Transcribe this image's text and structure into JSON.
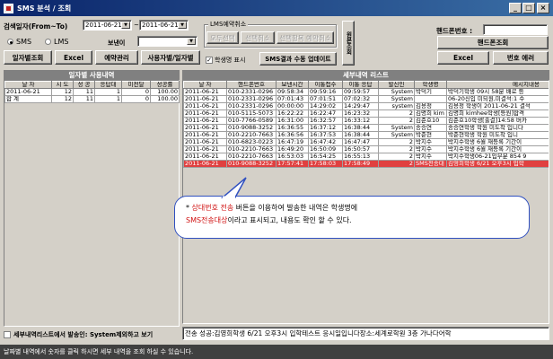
{
  "window": {
    "title": "SMS 분석 / 조회"
  },
  "search": {
    "period_label": "검색일자(From~To)",
    "from_date": "2011-06-21",
    "to_date": "2011-06-21",
    "tilde": "~",
    "radio_sms": "SMS",
    "radio_lms": "LMS",
    "sender_label": "보낸이",
    "sender_value": "",
    "btn_daily": "일자별조회",
    "btn_excel": "Excel",
    "btn_reserve": "예약관리",
    "btn_user": "사용자별/일자별"
  },
  "lms": {
    "group_label": "LMS예약취소",
    "btn_select_all": "모두선택",
    "btn_cancel_selected": "선택취소",
    "btn_register_cancel": "선택항목 예약취소",
    "vertical_btn": "원본조회",
    "show_student_label": "학생명 표시",
    "show_student_checked": true,
    "btn_manual_update": "SMS결과 수동 업데이트"
  },
  "phone": {
    "label": "핸드폰번호 :",
    "value": "",
    "btn_lookup": "핸드폰조회",
    "btn_excel": "Excel",
    "btn_number_error": "번호 에러"
  },
  "daily": {
    "header": "일자별 사용내역",
    "columns": [
      "날 자",
      "시 도",
      "성 공",
      "응답대",
      "미전달",
      "성공률"
    ],
    "rows": [
      [
        "2011-06-21",
        "12",
        "11",
        "1",
        "0",
        "100.00"
      ],
      [
        "합 계",
        "12",
        "11",
        "1",
        "0",
        "100.00"
      ]
    ],
    "filter_label": "세부내역리스트에서 발송인: System제외하고 보기",
    "filter_checked": false
  },
  "detail": {
    "header": "세부내역 리스트",
    "columns": [
      "날 자",
      "핸드폰번호",
      "보낸시간",
      "이통접수",
      "이통 응답",
      "발신인",
      "학생명",
      "메시지내용"
    ],
    "rows": [
      [
        "2011-06-21",
        "010-2331-0296",
        "09:58:34",
        "09:59:16",
        "09:59:57",
        "System",
        "박덕기",
        "박덕기학생 09시 58분 배로 등"
      ],
      [
        "2011-06-21",
        "010-2331-0296",
        "07:01:43",
        "07:01:51",
        "07:02:32",
        "System",
        "",
        "06-20신입 미되원,미결석:1 수"
      ],
      [
        "2011-06-21",
        "010-2331-0296",
        "00:00:00",
        "14:29:02",
        "14:29:47",
        "system",
        "김용정",
        "김용정 학생이 2011-06-21 결석"
      ],
      [
        "2011-06-21",
        "010-5115-5073",
        "16:22:22",
        "16:22:47",
        "16:23:32",
        "2",
        "김명희 kim",
        "김명희 kimhee학생[등원]합격"
      ],
      [
        "2011-06-21",
        "010-7766-0589",
        "16:31:00",
        "16:32:57",
        "16:33:12",
        "2",
        "김준호10",
        "김준호10학생[출결]14:58 버카"
      ],
      [
        "2011-06-21",
        "010-9088-3252",
        "16:36:55",
        "16:37:12",
        "16:38:44",
        "System",
        "송승연",
        "송승연학생 학원 미도착 입니다"
      ],
      [
        "2011-06-21",
        "010-2210-7663",
        "16:36:56",
        "16:37:53",
        "16:38:44",
        "System",
        "박준현",
        "박준현학생 학원 미도착 입니"
      ],
      [
        "2011-06-21",
        "010-6823-0223",
        "16:47:19",
        "16:47:42",
        "16:47:47",
        "2",
        "박지수",
        "박지수학생 6월 재등록 기간이"
      ],
      [
        "2011-06-21",
        "010-2210-7663",
        "16:49:20",
        "16:50:09",
        "16:50:57",
        "2",
        "박지수",
        "박지수학생 6월 재등록 기간이"
      ],
      [
        "2011-06-21",
        "010-2210-7663",
        "16:53:03",
        "16:54:25",
        "16:55:13",
        "2",
        "박지수",
        "박지수학생06-21입부분 854 9"
      ],
      [
        "2011-06-21",
        "010-9088-3252",
        "17:57:41",
        "17:58:03",
        "17:58:49",
        "2",
        "SMS전송대",
        "김영희학생 6/21 오후3시 입학"
      ]
    ],
    "selected_row": 10,
    "message_preview": "전송 성공:김영희학생 6/21 오후3시 입학테스트 응시일입니다장소:세계로학원 3층 가나다어학"
  },
  "callout": {
    "bullet": "*",
    "highlight1": "상대번호 전송",
    "text1": " 버튼을 이용하여 발송한 내역은 학생명에",
    "highlight2": "SMS전송대상",
    "text2": "이라고 표시되고, 내용도 확인 할 수 있다."
  },
  "status": {
    "text": "날짜별 내역에서 숫자를 클릭 하시면 세부 내역을 조회 하실 수 있습니다."
  },
  "colors": {
    "title_bar": "#0a246a",
    "highlight_red": "#d01010",
    "callout_border": "#3050c0",
    "selected_row": "#e04040"
  }
}
